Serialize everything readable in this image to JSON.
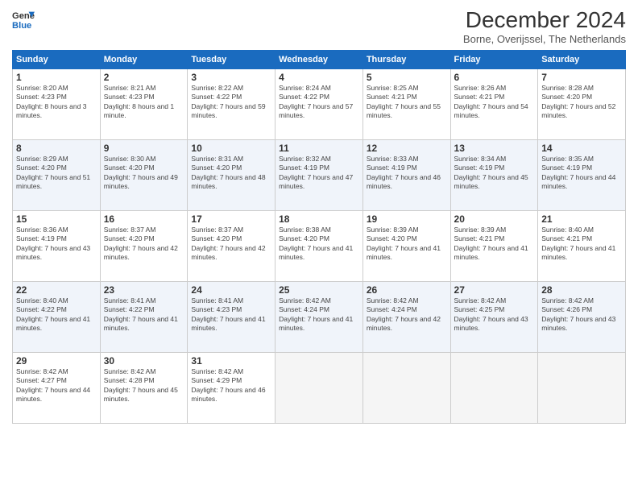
{
  "header": {
    "logo_line1": "General",
    "logo_line2": "Blue",
    "title": "December 2024",
    "subtitle": "Borne, Overijssel, The Netherlands"
  },
  "days_of_week": [
    "Sunday",
    "Monday",
    "Tuesday",
    "Wednesday",
    "Thursday",
    "Friday",
    "Saturday"
  ],
  "weeks": [
    [
      {
        "day": 1,
        "sunrise": "8:20 AM",
        "sunset": "4:23 PM",
        "daylight": "8 hours and 3 minutes."
      },
      {
        "day": 2,
        "sunrise": "8:21 AM",
        "sunset": "4:23 PM",
        "daylight": "8 hours and 1 minute."
      },
      {
        "day": 3,
        "sunrise": "8:22 AM",
        "sunset": "4:22 PM",
        "daylight": "7 hours and 59 minutes."
      },
      {
        "day": 4,
        "sunrise": "8:24 AM",
        "sunset": "4:22 PM",
        "daylight": "7 hours and 57 minutes."
      },
      {
        "day": 5,
        "sunrise": "8:25 AM",
        "sunset": "4:21 PM",
        "daylight": "7 hours and 55 minutes."
      },
      {
        "day": 6,
        "sunrise": "8:26 AM",
        "sunset": "4:21 PM",
        "daylight": "7 hours and 54 minutes."
      },
      {
        "day": 7,
        "sunrise": "8:28 AM",
        "sunset": "4:20 PM",
        "daylight": "7 hours and 52 minutes."
      }
    ],
    [
      {
        "day": 8,
        "sunrise": "8:29 AM",
        "sunset": "4:20 PM",
        "daylight": "7 hours and 51 minutes."
      },
      {
        "day": 9,
        "sunrise": "8:30 AM",
        "sunset": "4:20 PM",
        "daylight": "7 hours and 49 minutes."
      },
      {
        "day": 10,
        "sunrise": "8:31 AM",
        "sunset": "4:20 PM",
        "daylight": "7 hours and 48 minutes."
      },
      {
        "day": 11,
        "sunrise": "8:32 AM",
        "sunset": "4:19 PM",
        "daylight": "7 hours and 47 minutes."
      },
      {
        "day": 12,
        "sunrise": "8:33 AM",
        "sunset": "4:19 PM",
        "daylight": "7 hours and 46 minutes."
      },
      {
        "day": 13,
        "sunrise": "8:34 AM",
        "sunset": "4:19 PM",
        "daylight": "7 hours and 45 minutes."
      },
      {
        "day": 14,
        "sunrise": "8:35 AM",
        "sunset": "4:19 PM",
        "daylight": "7 hours and 44 minutes."
      }
    ],
    [
      {
        "day": 15,
        "sunrise": "8:36 AM",
        "sunset": "4:19 PM",
        "daylight": "7 hours and 43 minutes."
      },
      {
        "day": 16,
        "sunrise": "8:37 AM",
        "sunset": "4:20 PM",
        "daylight": "7 hours and 42 minutes."
      },
      {
        "day": 17,
        "sunrise": "8:37 AM",
        "sunset": "4:20 PM",
        "daylight": "7 hours and 42 minutes."
      },
      {
        "day": 18,
        "sunrise": "8:38 AM",
        "sunset": "4:20 PM",
        "daylight": "7 hours and 41 minutes."
      },
      {
        "day": 19,
        "sunrise": "8:39 AM",
        "sunset": "4:20 PM",
        "daylight": "7 hours and 41 minutes."
      },
      {
        "day": 20,
        "sunrise": "8:39 AM",
        "sunset": "4:21 PM",
        "daylight": "7 hours and 41 minutes."
      },
      {
        "day": 21,
        "sunrise": "8:40 AM",
        "sunset": "4:21 PM",
        "daylight": "7 hours and 41 minutes."
      }
    ],
    [
      {
        "day": 22,
        "sunrise": "8:40 AM",
        "sunset": "4:22 PM",
        "daylight": "7 hours and 41 minutes."
      },
      {
        "day": 23,
        "sunrise": "8:41 AM",
        "sunset": "4:22 PM",
        "daylight": "7 hours and 41 minutes."
      },
      {
        "day": 24,
        "sunrise": "8:41 AM",
        "sunset": "4:23 PM",
        "daylight": "7 hours and 41 minutes."
      },
      {
        "day": 25,
        "sunrise": "8:42 AM",
        "sunset": "4:24 PM",
        "daylight": "7 hours and 41 minutes."
      },
      {
        "day": 26,
        "sunrise": "8:42 AM",
        "sunset": "4:24 PM",
        "daylight": "7 hours and 42 minutes."
      },
      {
        "day": 27,
        "sunrise": "8:42 AM",
        "sunset": "4:25 PM",
        "daylight": "7 hours and 43 minutes."
      },
      {
        "day": 28,
        "sunrise": "8:42 AM",
        "sunset": "4:26 PM",
        "daylight": "7 hours and 43 minutes."
      }
    ],
    [
      {
        "day": 29,
        "sunrise": "8:42 AM",
        "sunset": "4:27 PM",
        "daylight": "7 hours and 44 minutes."
      },
      {
        "day": 30,
        "sunrise": "8:42 AM",
        "sunset": "4:28 PM",
        "daylight": "7 hours and 45 minutes."
      },
      {
        "day": 31,
        "sunrise": "8:42 AM",
        "sunset": "4:29 PM",
        "daylight": "7 hours and 46 minutes."
      },
      null,
      null,
      null,
      null
    ]
  ]
}
